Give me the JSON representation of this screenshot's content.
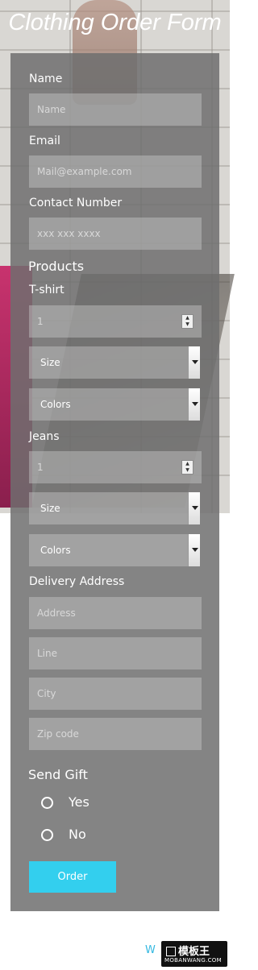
{
  "page": {
    "title": "Clothing Order Form"
  },
  "form": {
    "name": {
      "label": "Name",
      "placeholder": "Name"
    },
    "email": {
      "label": "Email",
      "placeholder": "Mail@example.com"
    },
    "contact": {
      "label": "Contact Number",
      "placeholder": "xxx xxx xxxx"
    },
    "products_heading": "Products",
    "tshirt": {
      "label": "T-shirt",
      "quantity": "1",
      "size": "Size",
      "colors": "Colors"
    },
    "jeans": {
      "label": "Jeans",
      "quantity": "1",
      "size": "Size",
      "colors": "Colors"
    },
    "delivery": {
      "label": "Delivery Address",
      "address_placeholder": "Address",
      "line_placeholder": "Line",
      "city_placeholder": "City",
      "zip_placeholder": "Zip code"
    },
    "gift": {
      "label": "Send Gift",
      "options": [
        "Yes",
        "No"
      ]
    },
    "submit_label": "Order"
  },
  "footer": {
    "text": "W",
    "logo_top": "模板王",
    "logo_bottom": "MOBANWANG.COM"
  },
  "colors": {
    "accent": "#33cfee",
    "panel": "#6e6e6e"
  }
}
